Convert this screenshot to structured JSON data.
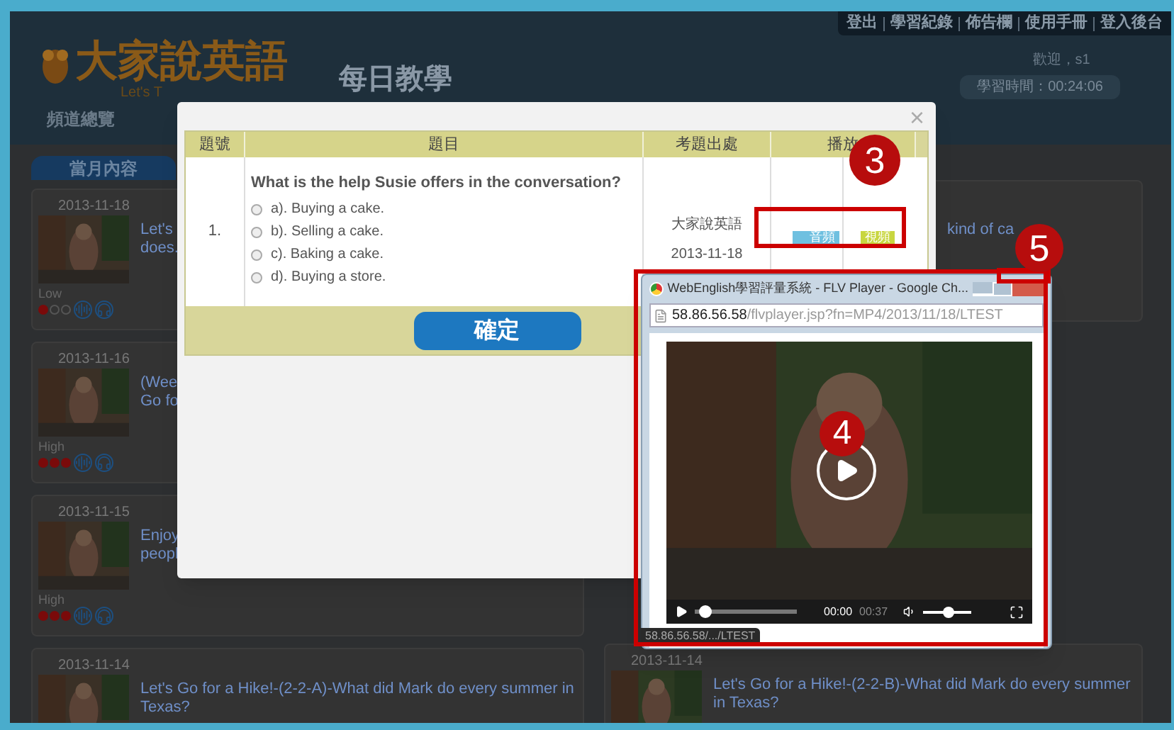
{
  "header": {
    "logo": "大家說英語",
    "tagline": "Let's T",
    "section_title": "每日教學",
    "top_links": [
      "登出",
      "學習紀錄",
      "佈告欄",
      "使用手冊",
      "登入後台"
    ],
    "welcome": "歡迎，s1",
    "study_time": "學習時間：00:24:06"
  },
  "nav": [
    "頻道總覽"
  ],
  "panel_title": "當月內容",
  "left_cards": [
    {
      "date": "2013-11-18",
      "level": "Low",
      "stars": 1,
      "lines": [
        {
          "kind": "title",
          "text": "Let's"
        },
        {
          "kind": "title",
          "text": "does."
        }
      ]
    },
    {
      "date": "2013-11-16",
      "level": "High",
      "stars": 3,
      "lines": [
        {
          "kind": "title",
          "text": "(Wee"
        },
        {
          "kind": "title",
          "text": "Go fo"
        }
      ]
    },
    {
      "date": "2013-11-15",
      "level": "High",
      "stars": 3,
      "lines": [
        {
          "kind": "title",
          "text": "Enjoy"
        },
        {
          "kind": "title",
          "text": "peopl"
        }
      ]
    },
    {
      "date": "2013-11-14",
      "lines": [
        {
          "kind": "title",
          "text": "Let's Go for a Hike!-(2-2-A)-What did Mark do every summer in Texas?"
        }
      ]
    }
  ],
  "right_cards": [
    {
      "lines": [
        {
          "kind": "title",
          "text": "kind of ca"
        }
      ]
    },
    {
      "date": "2013-11-14",
      "lines": [
        {
          "kind": "title",
          "text": "Let's Go for a Hike!-(2-2-B)-What did Mark do every summer in Texas?"
        }
      ]
    }
  ],
  "modal": {
    "close": "×",
    "columns": [
      "題號",
      "題目",
      "考題出處",
      "播放"
    ],
    "rows": [
      {
        "number": "1.",
        "question": "What is the help Susie offers in the conversation?",
        "options": [
          {
            "label": "a). Buying a cake.",
            "selected": false
          },
          {
            "label": "b). Selling a cake.",
            "selected": false
          },
          {
            "label": "c). Baking a cake.",
            "selected": false
          },
          {
            "label": "d). Buying a store.",
            "selected": false
          }
        ],
        "source": "大家說英語",
        "source_date": "2013-11-18",
        "audio_button": "音頻",
        "video_button": "視頻"
      }
    ],
    "confirm_button": "確定"
  },
  "player": {
    "title": "WebEnglish學習評量系統 - FLV Player - Google Ch...",
    "url_host": "58.86.56.58",
    "url_path": "/flvplayer.jsp?fn=MP4/2013/11/18/LTEST",
    "position": {
      "level": 0.04
    },
    "elapsed": "00:00",
    "duration": "00:37",
    "volume": {
      "level": 0.55
    },
    "status": "58.86.56.58/.../LTEST"
  },
  "annotations": [
    {
      "label": "3"
    },
    {
      "label": "4"
    },
    {
      "label": "5"
    }
  ]
}
